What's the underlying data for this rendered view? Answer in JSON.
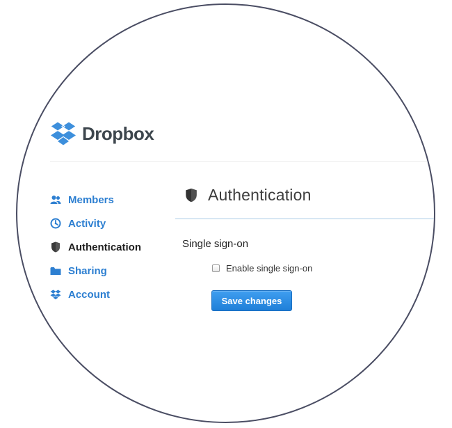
{
  "brand": {
    "name": "Dropbox",
    "logo_icon": "dropbox-logo-icon",
    "colors": {
      "logo_blue": "#3d8fdc",
      "logo_text": "#3d464d",
      "link_blue": "#2d7fd1",
      "button_blue": "#2a8ae2",
      "frame": "#4a4d63"
    }
  },
  "sidebar": {
    "items": [
      {
        "label": "Members",
        "icon": "members-icon",
        "active": false
      },
      {
        "label": "Activity",
        "icon": "activity-icon",
        "active": false
      },
      {
        "label": "Authentication",
        "icon": "shield-icon",
        "active": true
      },
      {
        "label": "Sharing",
        "icon": "folder-icon",
        "active": false
      },
      {
        "label": "Account",
        "icon": "dropbox-icon",
        "active": false
      }
    ]
  },
  "main": {
    "title": "Authentication",
    "title_icon": "shield-icon",
    "section_title": "Single sign-on",
    "sso_checkbox": {
      "label": "Enable single sign-on",
      "checked": false
    },
    "save_button": {
      "label": "Save changes"
    }
  }
}
